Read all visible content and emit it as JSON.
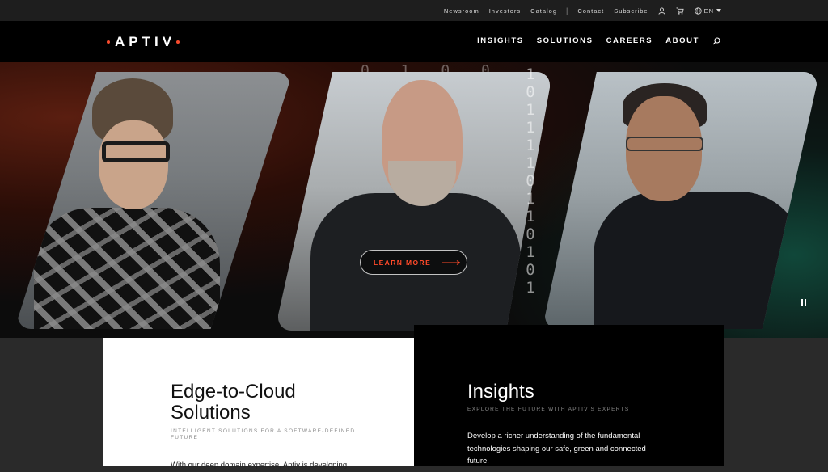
{
  "utility_nav": {
    "links": [
      "Newsroom",
      "Investors",
      "Catalog"
    ],
    "links2": [
      "Contact",
      "Subscribe"
    ],
    "language": "EN"
  },
  "brand": {
    "logo_text": "APTIV",
    "accent_color": "#f84b2d"
  },
  "main_nav": {
    "items": [
      "INSIGHTS",
      "SOLUTIONS",
      "CAREERS",
      "ABOUT"
    ]
  },
  "hero": {
    "cta_label": "LEARN MORE",
    "binary_row": "0 1 0 0",
    "binary_col": [
      "1",
      "0",
      "1",
      "1",
      "1",
      "1",
      "0",
      "1",
      "1",
      "0",
      "1",
      "0",
      "1"
    ]
  },
  "cards": {
    "left": {
      "title_line1": "Edge-to-Cloud",
      "title_line2": "Solutions",
      "subtitle": "Intelligent solutions for a software-defined future",
      "body": "With our deep domain expertise, Aptiv is developing"
    },
    "right": {
      "title": "Insights",
      "subtitle": "Explore the future with Aptiv's experts",
      "body": "Develop a richer understanding of the fundamental technologies shaping our safe, green and connected future."
    }
  }
}
